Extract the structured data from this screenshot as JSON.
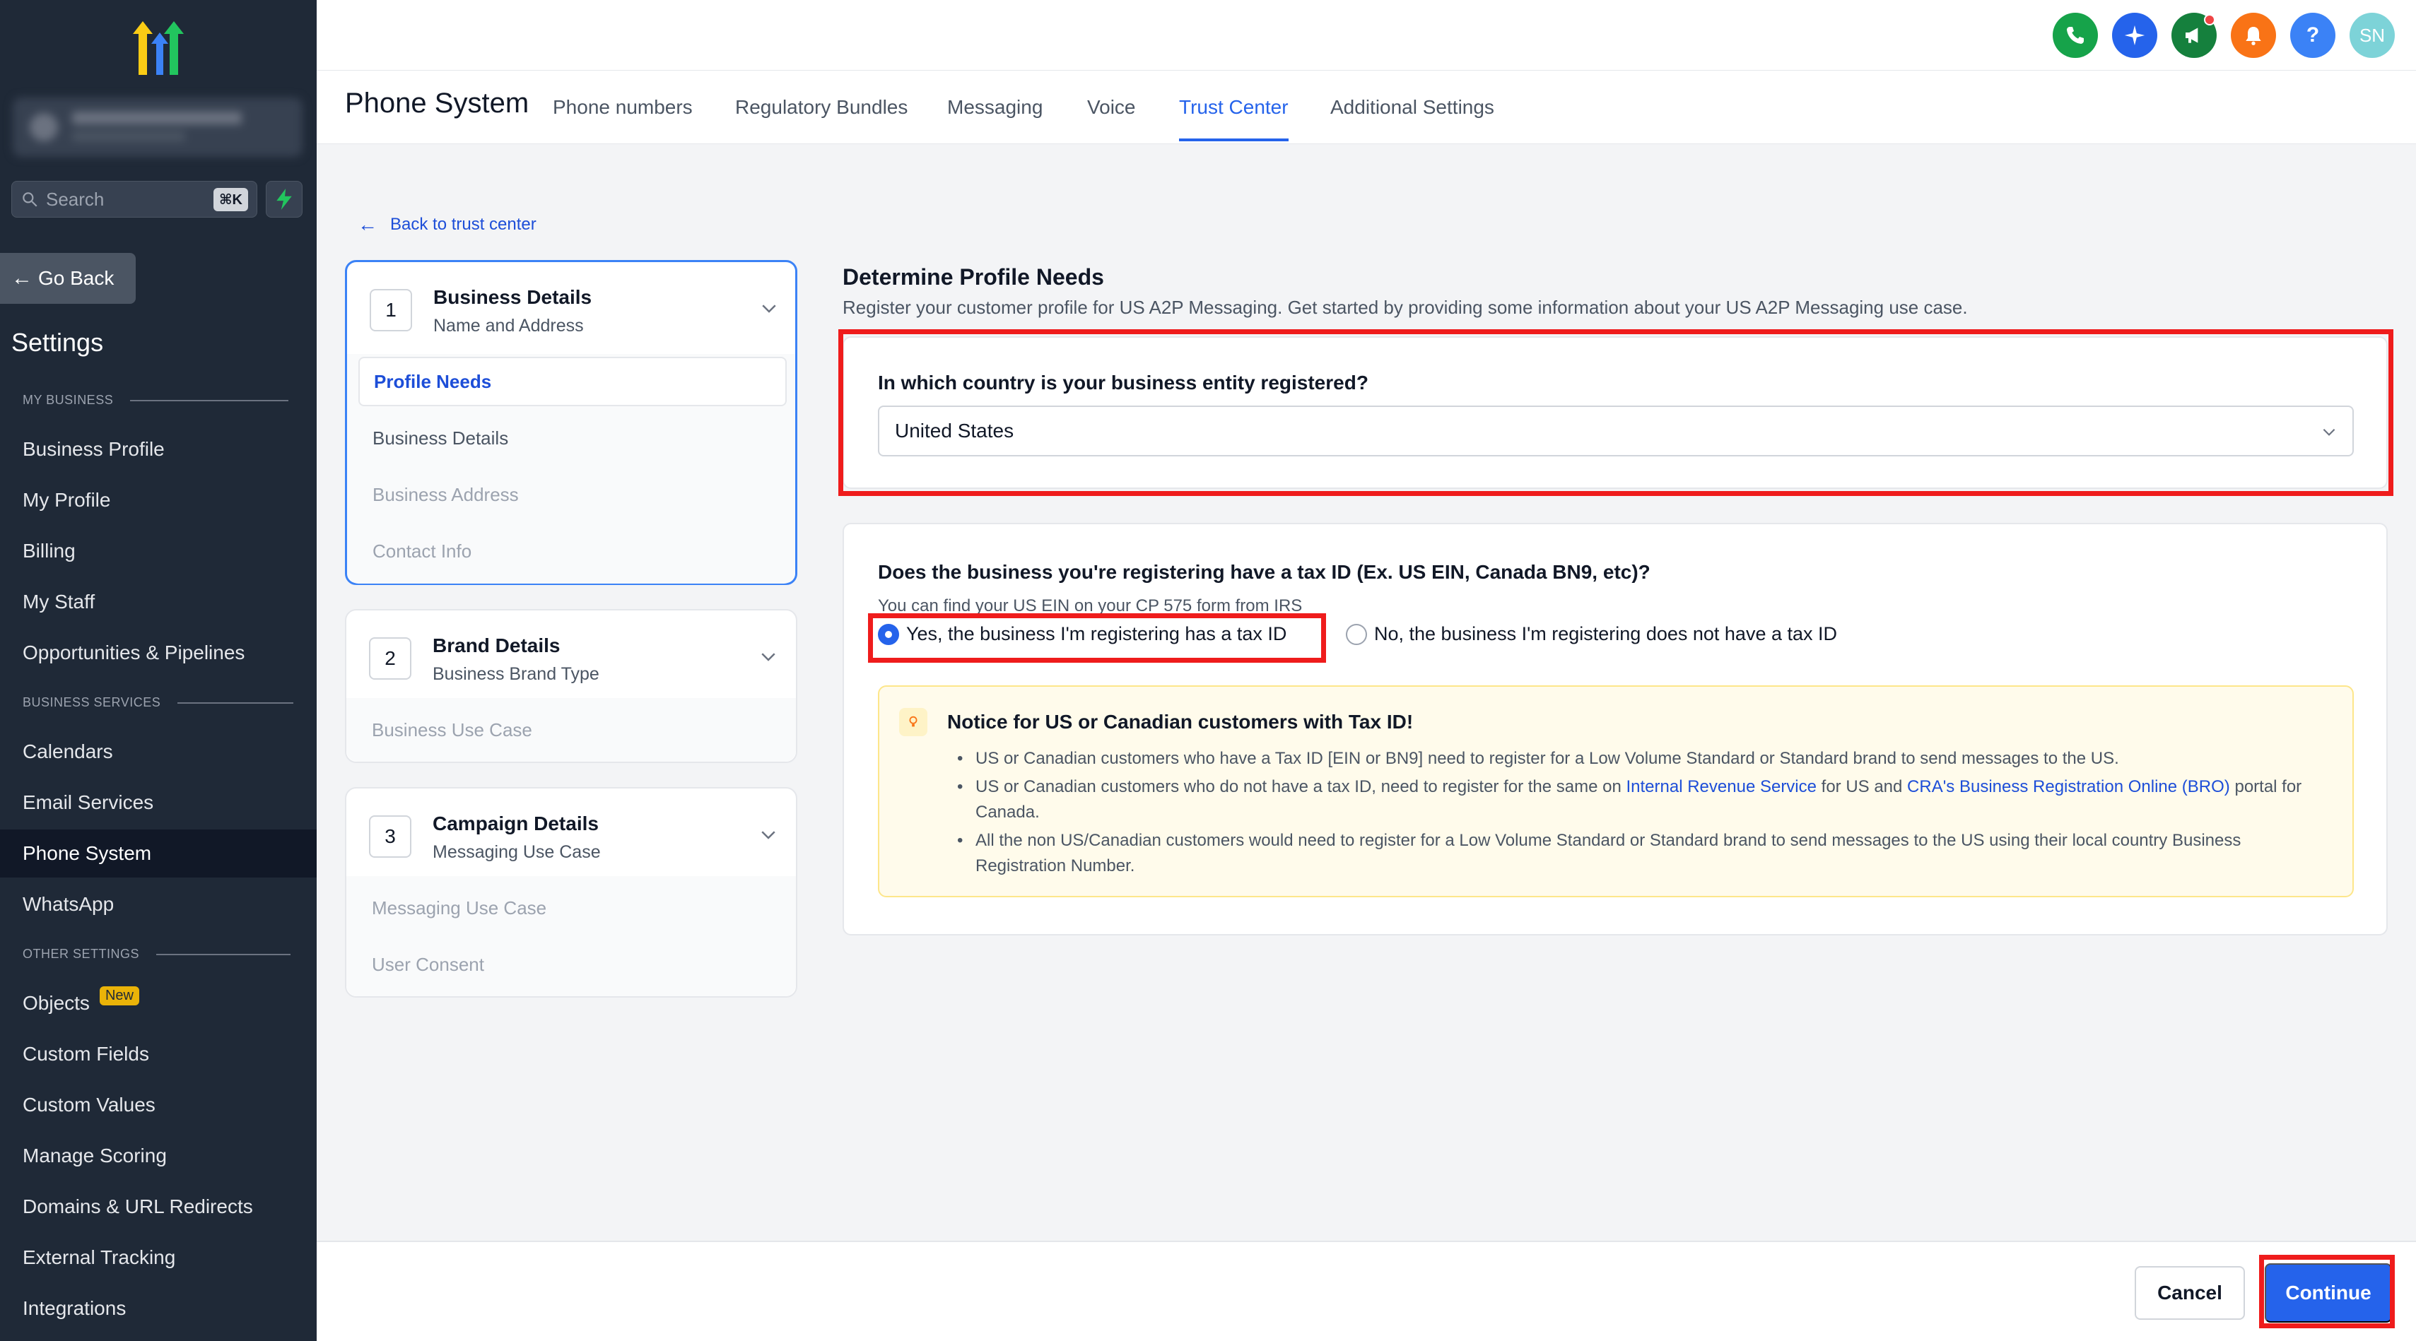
{
  "sidebar": {
    "search_placeholder": "Search",
    "search_shortcut": "⌘K",
    "go_back": "Go Back",
    "settings_title": "Settings",
    "sections": [
      {
        "label": "MY BUSINESS"
      },
      {
        "label": "BUSINESS SERVICES"
      },
      {
        "label": "OTHER SETTINGS"
      }
    ],
    "items": [
      {
        "label": "Business Profile"
      },
      {
        "label": "My Profile"
      },
      {
        "label": "Billing"
      },
      {
        "label": "My Staff"
      },
      {
        "label": "Opportunities & Pipelines"
      },
      {
        "label": "Calendars"
      },
      {
        "label": "Email Services"
      },
      {
        "label": "Phone System",
        "active": true
      },
      {
        "label": "WhatsApp"
      },
      {
        "label": "Objects",
        "badge": "New"
      },
      {
        "label": "Custom Fields"
      },
      {
        "label": "Custom Values"
      },
      {
        "label": "Manage Scoring"
      },
      {
        "label": "Domains & URL Redirects"
      },
      {
        "label": "External Tracking"
      },
      {
        "label": "Integrations"
      }
    ]
  },
  "topbar": {
    "icons": [
      {
        "name": "phone-icon",
        "color": "#16a34a"
      },
      {
        "name": "sparkle-icon",
        "color": "#2563eb"
      },
      {
        "name": "megaphone-icon",
        "color": "#15803d"
      },
      {
        "name": "bell-icon",
        "color": "#f97316"
      },
      {
        "name": "help-icon",
        "color": "#3b82f6",
        "glyph": "?"
      },
      {
        "name": "avatar",
        "color": "#7dd3d8",
        "glyph": "SN"
      }
    ]
  },
  "header": {
    "title": "Phone System",
    "tabs": [
      {
        "label": "Phone numbers"
      },
      {
        "label": "Regulatory Bundles"
      },
      {
        "label": "Messaging"
      },
      {
        "label": "Voice"
      },
      {
        "label": "Trust Center",
        "active": true
      },
      {
        "label": "Additional Settings"
      }
    ]
  },
  "back_link": "Back to trust center",
  "steps": [
    {
      "number": "1",
      "title": "Business Details",
      "subtitle": "Name and Address",
      "items": [
        {
          "label": "Profile Needs",
          "state": "selected"
        },
        {
          "label": "Business Details",
          "state": "normal"
        },
        {
          "label": "Business Address",
          "state": "muted"
        },
        {
          "label": "Contact Info",
          "state": "muted"
        }
      ]
    },
    {
      "number": "2",
      "title": "Brand Details",
      "subtitle": "Business Brand Type",
      "items": [
        {
          "label": "Business Use Case",
          "state": "muted"
        }
      ]
    },
    {
      "number": "3",
      "title": "Campaign Details",
      "subtitle": "Messaging Use Case",
      "items": [
        {
          "label": "Messaging Use Case",
          "state": "muted"
        },
        {
          "label": "User Consent",
          "state": "muted"
        }
      ]
    }
  ],
  "main": {
    "title": "Determine Profile Needs",
    "description": "Register your customer profile for US A2P Messaging. Get started by providing some information about your US A2P Messaging use case.",
    "country_question": "In which country is your business entity registered?",
    "country_value": "United States",
    "tax_question": "Does the business you're registering have a tax ID (Ex. US EIN, Canada BN9, etc)?",
    "tax_hint": "You can find your US EIN on your CP 575 form from IRS",
    "radio_yes": "Yes, the business I'm registering has a tax ID",
    "radio_no": "No, the business I'm registering does not have a tax ID",
    "radio_selected": "yes",
    "notice_title": "Notice for US or Canadian customers with Tax ID!",
    "notice_1": "US or Canadian customers who have a Tax ID [EIN or BN9] need to register for a Low Volume Standard or Standard brand to send messages to the US.",
    "notice_2_a": "US or Canadian customers who do not have a tax ID, need to register for the same on ",
    "notice_2_link1": "Internal Revenue Service",
    "notice_2_b": " for US and ",
    "notice_2_link2": "CRA's Business Registration Online (BRO)",
    "notice_2_c": " portal for Canada.",
    "notice_3": "All the non US/Canadian customers would need to register for a Low Volume Standard or Standard brand to send messages to the US using their local country Business Registration Number."
  },
  "footer": {
    "cancel": "Cancel",
    "continue": "Continue"
  },
  "colors": {
    "accent": "#2563eb",
    "highlight": "#ef1c1c",
    "sidebar_bg": "#1f2937"
  }
}
